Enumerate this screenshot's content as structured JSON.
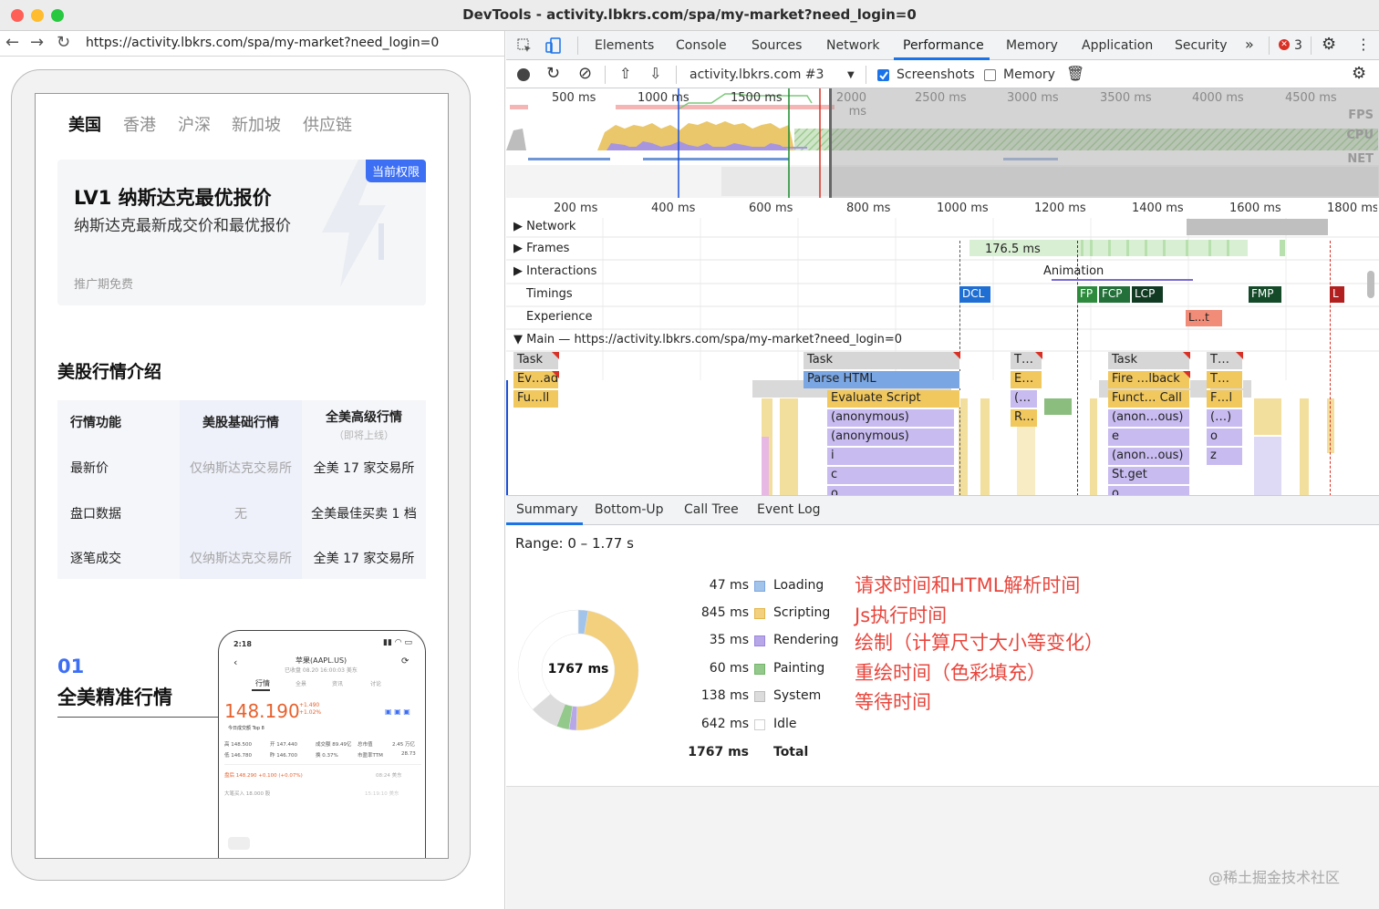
{
  "window": {
    "title": "DevTools - activity.lbkrs.com/spa/my-market?need_login=0"
  },
  "browser": {
    "url": "https://activity.lbkrs.com/spa/my-market?need_login=0"
  },
  "page": {
    "tabs": [
      "美国",
      "香港",
      "沪深",
      "新加坡",
      "供应链"
    ],
    "card": {
      "badge": "当前权限",
      "title": "LV1 纳斯达克最优报价",
      "subtitle": "纳斯达克最新成交价和最优报价",
      "footnote": "推广期免费"
    },
    "section_title": "美股行情介绍",
    "table": {
      "headers": [
        "行情功能",
        "美股基础行情",
        "全美高级行情"
      ],
      "header_note": "（即将上线）",
      "rows": [
        [
          "最新价",
          "仅纳斯达克交易所",
          "全美 17 家交易所"
        ],
        [
          "盘口数据",
          "无",
          "全美最佳买卖 1 档"
        ],
        [
          "逐笔成交",
          "仅纳斯达克交易所",
          "全美 17 家交易所"
        ]
      ]
    },
    "feature": {
      "number": "01",
      "title": "全美精准行情"
    },
    "phone": {
      "time": "2:18",
      "stock_name": "苹果(AAPL.US)",
      "status": "已收盘 08.20 16:00:03 美东",
      "tabs": [
        "行情",
        "全景",
        "资讯",
        "讨论"
      ],
      "price": "148.190",
      "change": "+1.490",
      "change_pct": "+1.02%",
      "volume_label": "今日成交额 Top 8",
      "row1": [
        "高 148.500",
        "开 147.440",
        "成交额 89.49亿",
        "总市值",
        "2.45 万亿"
      ],
      "row2": [
        "低 146.780",
        "昨 146.700",
        "换 0.37%",
        "市盈率TTM",
        "28.73"
      ],
      "ticker1": "盘后  148.290  +0.100 (+0.07%)",
      "ticker1_time": "08:24 美东",
      "ticker2": "大笔买入 18.000 股",
      "ticker2_time": "15:19:10 美东"
    }
  },
  "devtools": {
    "tabs": [
      "Elements",
      "Console",
      "Sources",
      "Network",
      "Performance",
      "Memory",
      "Application",
      "Security"
    ],
    "active_tab": "Performance",
    "more": "»",
    "error_count": "3",
    "toolbar": {
      "profile": "activity.lbkrs.com #3",
      "screenshots_label": "Screenshots",
      "memory_label": "Memory"
    },
    "overview_ticks": [
      "500 ms",
      "1000 ms",
      "1500 ms",
      "2000 ms",
      "2500 ms",
      "3000 ms",
      "3500 ms",
      "4000 ms",
      "4500 ms"
    ],
    "overview_labels": [
      "FPS",
      "CPU",
      "NET"
    ],
    "timeline_ticks": [
      "200 ms",
      "400 ms",
      "600 ms",
      "800 ms",
      "1000 ms",
      "1200 ms",
      "1400 ms",
      "1600 ms",
      "1800 ms"
    ],
    "tracks": {
      "network": "Network",
      "frames": "Frames",
      "frame_time": "176.5 ms",
      "interactions": "Interactions",
      "animation": "Animation",
      "timings": "Timings",
      "experience": "Experience",
      "main": "Main — https://activity.lbkrs.com/spa/my-market?need_login=0"
    },
    "timing_markers": [
      "DCL",
      "FP",
      "FCP",
      "LCP",
      "FMP",
      "L"
    ],
    "experience_marker": "L...t",
    "flame": {
      "col1": [
        "Task",
        "Ev…ad",
        "Fu…ll"
      ],
      "col2": [
        "Task",
        "Parse HTML",
        "Evaluate Script",
        "(anonymous)",
        "(anonymous)",
        "i",
        "c",
        "o"
      ],
      "col3": [
        "T…",
        "E…",
        "(…",
        "R…"
      ],
      "col4": [
        "Task",
        "Fire …lback",
        "Funct… Call",
        "(anon…ous)",
        "e",
        "(anon…ous)",
        "St.get",
        "o"
      ],
      "col5": [
        "T…",
        "T…",
        "F…l",
        "(…)",
        "o",
        "z"
      ]
    },
    "subtabs": [
      "Summary",
      "Bottom-Up",
      "Call Tree",
      "Event Log"
    ],
    "range": "Range: 0 – 1.77 s",
    "summary": {
      "total_center": "1767 ms",
      "rows": [
        {
          "ms": "47 ms",
          "label": "Loading",
          "color": "#a3c4ea",
          "value": 47
        },
        {
          "ms": "845 ms",
          "label": "Scripting",
          "color": "#f2d07e",
          "value": 845
        },
        {
          "ms": "35 ms",
          "label": "Rendering",
          "color": "#b7a6e8",
          "value": 35
        },
        {
          "ms": "60 ms",
          "label": "Painting",
          "color": "#94c98c",
          "value": 60
        },
        {
          "ms": "138 ms",
          "label": "System",
          "color": "#dcdcdc",
          "value": 138
        },
        {
          "ms": "642 ms",
          "label": "Idle",
          "color": "#ffffff",
          "value": 642
        }
      ],
      "total_ms": "1767 ms",
      "total_label": "Total"
    },
    "annotations": [
      "请求时间和HTML解析时间",
      "Js执行时间",
      "绘制（计算尺寸大小等变化）",
      "重绘时间（色彩填充）",
      "等待时间"
    ]
  },
  "watermark": "@稀土掘金技术社区"
}
